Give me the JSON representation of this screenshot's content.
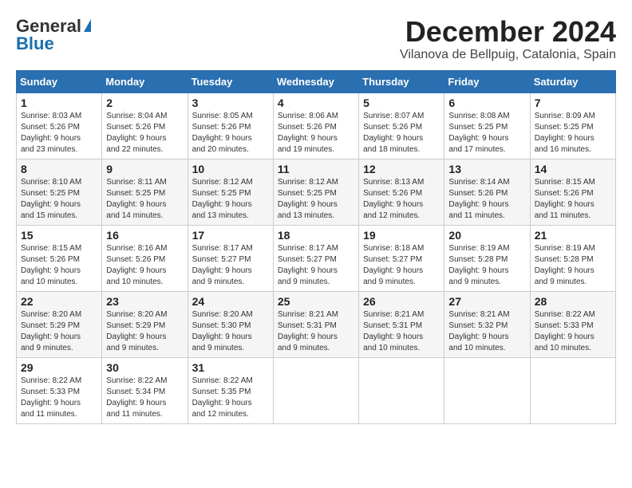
{
  "header": {
    "logo_general": "General",
    "logo_blue": "Blue",
    "month": "December 2024",
    "location": "Vilanova de Bellpuig, Catalonia, Spain"
  },
  "calendar": {
    "days_of_week": [
      "Sunday",
      "Monday",
      "Tuesday",
      "Wednesday",
      "Thursday",
      "Friday",
      "Saturday"
    ],
    "weeks": [
      [
        {
          "day": "",
          "info": ""
        },
        {
          "day": "2",
          "info": "Sunrise: 8:04 AM\nSunset: 5:26 PM\nDaylight: 9 hours and 22 minutes."
        },
        {
          "day": "3",
          "info": "Sunrise: 8:05 AM\nSunset: 5:26 PM\nDaylight: 9 hours and 20 minutes."
        },
        {
          "day": "4",
          "info": "Sunrise: 8:06 AM\nSunset: 5:26 PM\nDaylight: 9 hours and 19 minutes."
        },
        {
          "day": "5",
          "info": "Sunrise: 8:07 AM\nSunset: 5:26 PM\nDaylight: 9 hours and 18 minutes."
        },
        {
          "day": "6",
          "info": "Sunrise: 8:08 AM\nSunset: 5:25 PM\nDaylight: 9 hours and 17 minutes."
        },
        {
          "day": "7",
          "info": "Sunrise: 8:09 AM\nSunset: 5:25 PM\nDaylight: 9 hours and 16 minutes."
        }
      ],
      [
        {
          "day": "1",
          "info": "Sunrise: 8:03 AM\nSunset: 5:26 PM\nDaylight: 9 hours and 23 minutes.",
          "first_col": true
        },
        {
          "day": "8",
          "info": "Sunrise: 8:10 AM\nSunset: 5:25 PM\nDaylight: 9 hours and 15 minutes."
        },
        {
          "day": "9",
          "info": "Sunrise: 8:11 AM\nSunset: 5:25 PM\nDaylight: 9 hours and 14 minutes."
        },
        {
          "day": "10",
          "info": "Sunrise: 8:12 AM\nSunset: 5:25 PM\nDaylight: 9 hours and 13 minutes."
        },
        {
          "day": "11",
          "info": "Sunrise: 8:12 AM\nSunset: 5:25 PM\nDaylight: 9 hours and 13 minutes."
        },
        {
          "day": "12",
          "info": "Sunrise: 8:13 AM\nSunset: 5:26 PM\nDaylight: 9 hours and 12 minutes."
        },
        {
          "day": "13",
          "info": "Sunrise: 8:14 AM\nSunset: 5:26 PM\nDaylight: 9 hours and 11 minutes."
        },
        {
          "day": "14",
          "info": "Sunrise: 8:15 AM\nSunset: 5:26 PM\nDaylight: 9 hours and 11 minutes."
        }
      ],
      [
        {
          "day": "15",
          "info": "Sunrise: 8:15 AM\nSunset: 5:26 PM\nDaylight: 9 hours and 10 minutes."
        },
        {
          "day": "16",
          "info": "Sunrise: 8:16 AM\nSunset: 5:26 PM\nDaylight: 9 hours and 10 minutes."
        },
        {
          "day": "17",
          "info": "Sunrise: 8:17 AM\nSunset: 5:27 PM\nDaylight: 9 hours and 9 minutes."
        },
        {
          "day": "18",
          "info": "Sunrise: 8:17 AM\nSunset: 5:27 PM\nDaylight: 9 hours and 9 minutes."
        },
        {
          "day": "19",
          "info": "Sunrise: 8:18 AM\nSunset: 5:27 PM\nDaylight: 9 hours and 9 minutes."
        },
        {
          "day": "20",
          "info": "Sunrise: 8:19 AM\nSunset: 5:28 PM\nDaylight: 9 hours and 9 minutes."
        },
        {
          "day": "21",
          "info": "Sunrise: 8:19 AM\nSunset: 5:28 PM\nDaylight: 9 hours and 9 minutes."
        }
      ],
      [
        {
          "day": "22",
          "info": "Sunrise: 8:20 AM\nSunset: 5:29 PM\nDaylight: 9 hours and 9 minutes."
        },
        {
          "day": "23",
          "info": "Sunrise: 8:20 AM\nSunset: 5:29 PM\nDaylight: 9 hours and 9 minutes."
        },
        {
          "day": "24",
          "info": "Sunrise: 8:20 AM\nSunset: 5:30 PM\nDaylight: 9 hours and 9 minutes."
        },
        {
          "day": "25",
          "info": "Sunrise: 8:21 AM\nSunset: 5:31 PM\nDaylight: 9 hours and 9 minutes."
        },
        {
          "day": "26",
          "info": "Sunrise: 8:21 AM\nSunset: 5:31 PM\nDaylight: 9 hours and 10 minutes."
        },
        {
          "day": "27",
          "info": "Sunrise: 8:21 AM\nSunset: 5:32 PM\nDaylight: 9 hours and 10 minutes."
        },
        {
          "day": "28",
          "info": "Sunrise: 8:22 AM\nSunset: 5:33 PM\nDaylight: 9 hours and 10 minutes."
        }
      ],
      [
        {
          "day": "29",
          "info": "Sunrise: 8:22 AM\nSunset: 5:33 PM\nDaylight: 9 hours and 11 minutes."
        },
        {
          "day": "30",
          "info": "Sunrise: 8:22 AM\nSunset: 5:34 PM\nDaylight: 9 hours and 11 minutes."
        },
        {
          "day": "31",
          "info": "Sunrise: 8:22 AM\nSunset: 5:35 PM\nDaylight: 9 hours and 12 minutes."
        },
        {
          "day": "",
          "info": ""
        },
        {
          "day": "",
          "info": ""
        },
        {
          "day": "",
          "info": ""
        },
        {
          "day": "",
          "info": ""
        }
      ]
    ]
  }
}
